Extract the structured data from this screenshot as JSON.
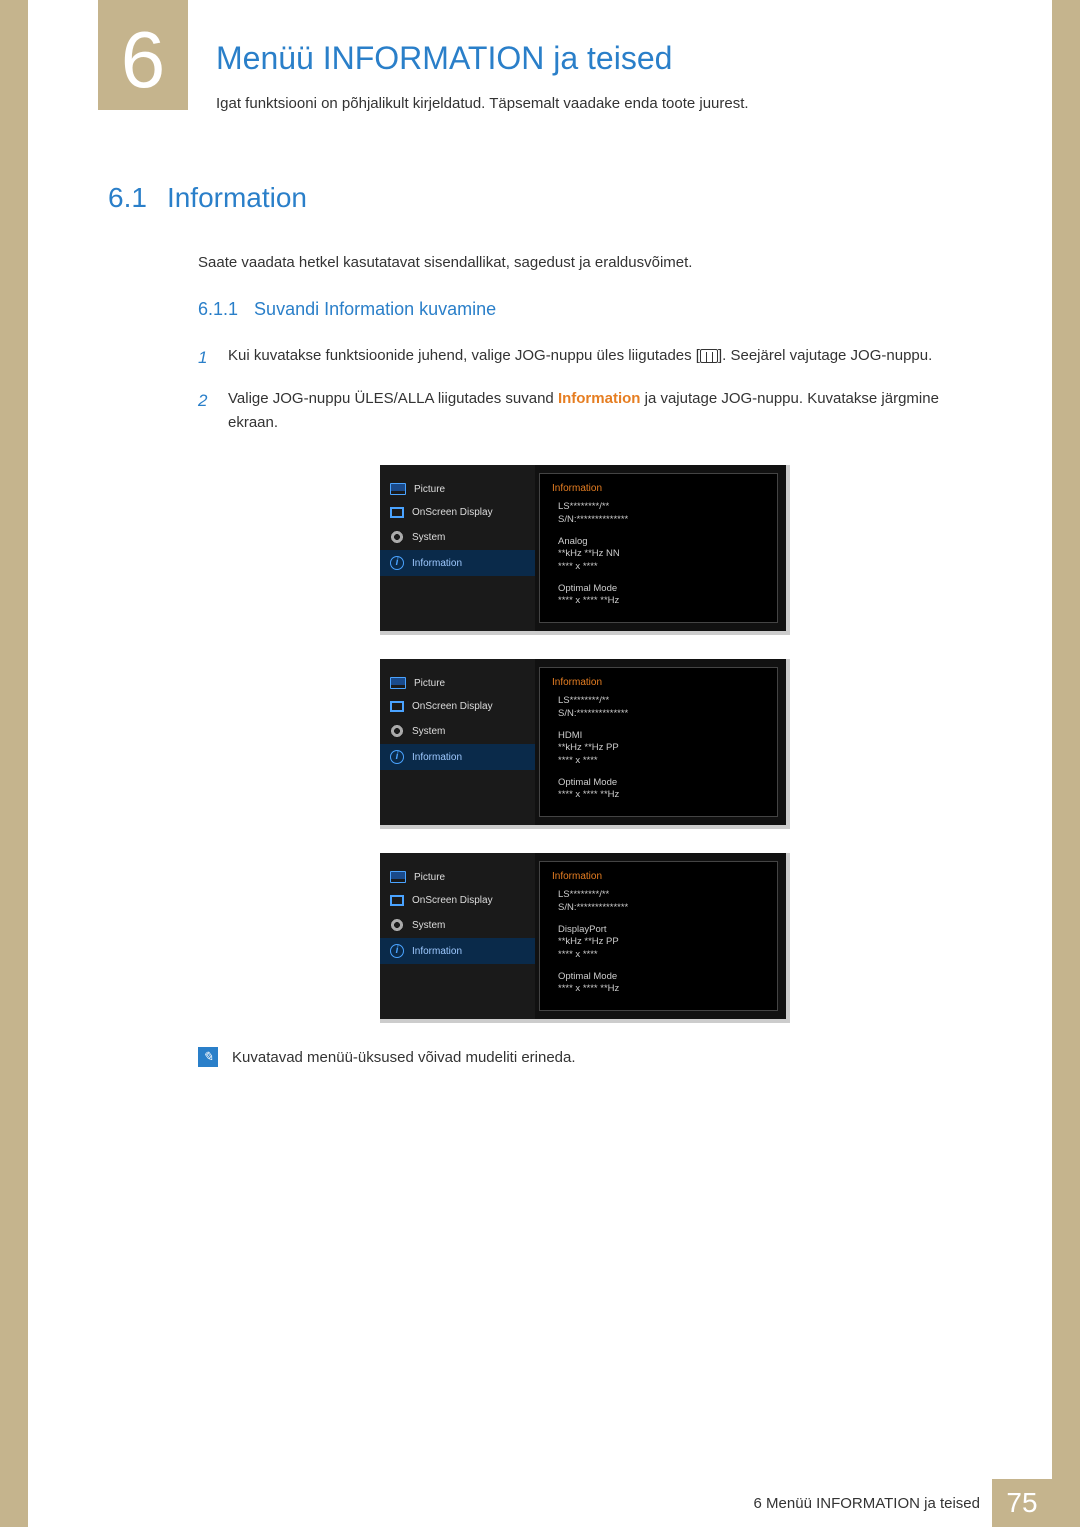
{
  "chapter": {
    "number": "6",
    "title": "Menüü INFORMATION ja teised",
    "description": "Igat funktsiooni on põhjalikult kirjeldatud. Täpsemalt vaadake enda toote juurest."
  },
  "section": {
    "number": "6.1",
    "title": "Information",
    "intro": "Saate vaadata hetkel kasutatavat sisendallikat, sagedust ja eraldusvõimet."
  },
  "subsection": {
    "number": "6.1.1",
    "title": "Suvandi Information kuvamine"
  },
  "steps": [
    {
      "num": "1",
      "text_before": "Kui kuvatakse funktsioonide juhend, valige JOG-nuppu üles liigutades [",
      "text_after": "]. Seejärel vajutage JOG-nuppu."
    },
    {
      "num": "2",
      "text_1": "Valige JOG-nuppu ÜLES/ALLA liigutades suvand ",
      "highlight": "Information",
      "text_2": " ja vajutage JOG-nuppu. Kuvatakse järgmine ekraan."
    }
  ],
  "osd_menu": {
    "items": [
      {
        "label": "Picture",
        "icon": "monitor"
      },
      {
        "label": "OnScreen Display",
        "icon": "screen"
      },
      {
        "label": "System",
        "icon": "gear"
      },
      {
        "label": "Information",
        "icon": "info",
        "selected": true
      }
    ],
    "panel_title": "Information"
  },
  "osd_panels": [
    {
      "model": "LS********/**",
      "sn": "S/N:**************",
      "source": "Analog",
      "freq": "**kHz **Hz NN",
      "res": "**** x ****",
      "mode_label": "Optimal Mode",
      "mode_val": "**** x **** **Hz"
    },
    {
      "model": "LS********/**",
      "sn": "S/N:**************",
      "source": "HDMI",
      "freq": "**kHz **Hz PP",
      "res": "**** x ****",
      "mode_label": "Optimal Mode",
      "mode_val": "**** x **** **Hz"
    },
    {
      "model": "LS********/**",
      "sn": "S/N:**************",
      "source": "DisplayPort",
      "freq": "**kHz **Hz PP",
      "res": "**** x ****",
      "mode_label": "Optimal Mode",
      "mode_val": "**** x **** **Hz"
    }
  ],
  "note": "Kuvatavad menüü-üksused võivad mudeliti erineda.",
  "footer": {
    "text": "6 Menüü INFORMATION ja teised",
    "page": "75"
  }
}
